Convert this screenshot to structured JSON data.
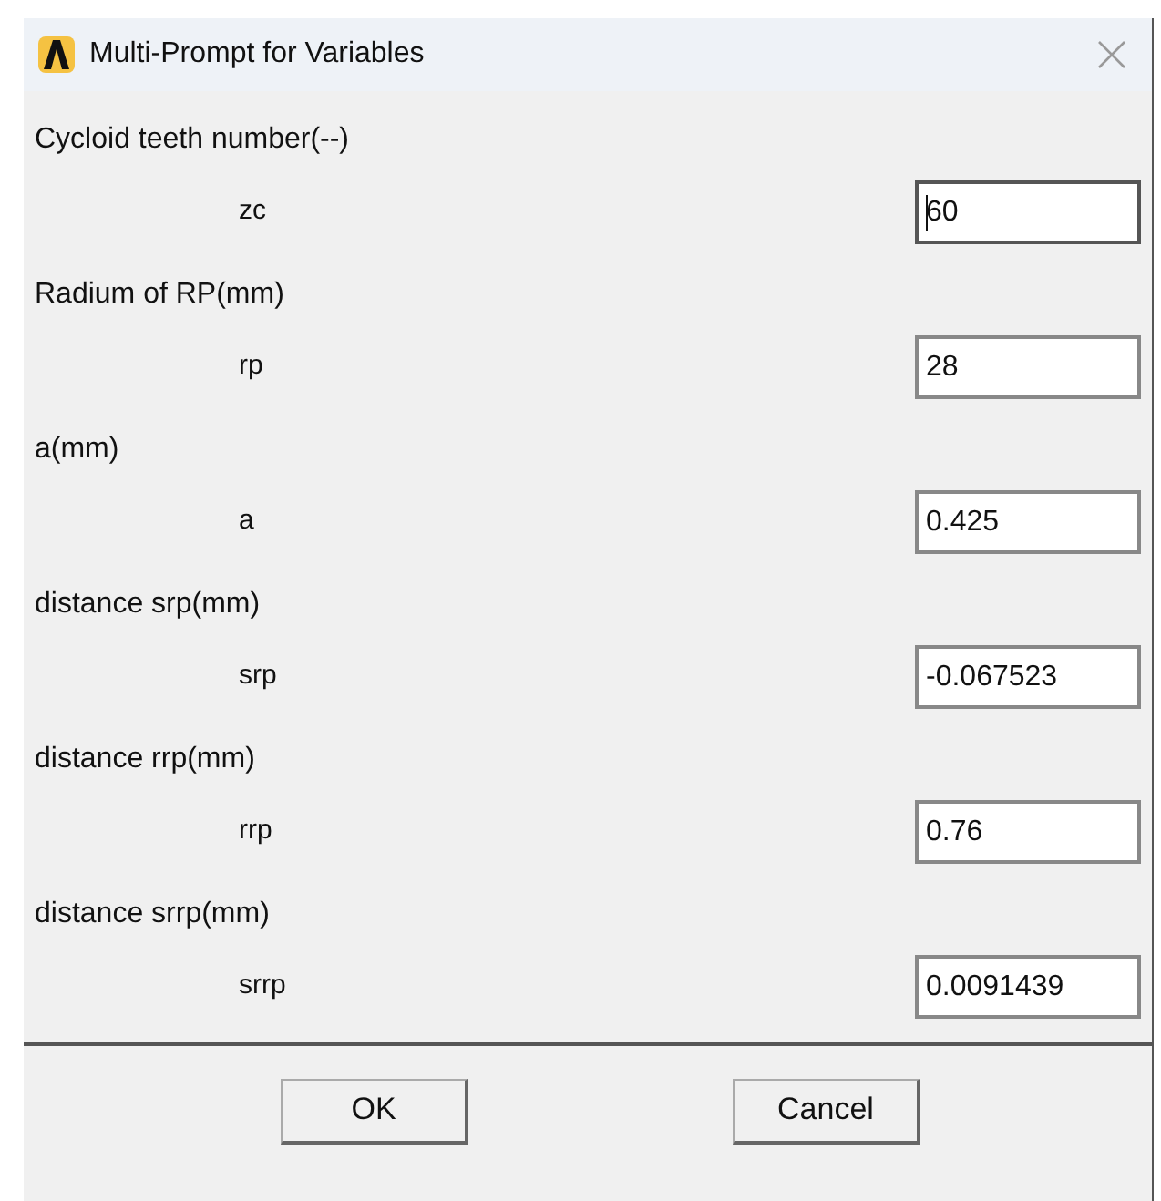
{
  "window": {
    "title": "Multi-Prompt for Variables"
  },
  "variables": [
    {
      "heading": "Cycloid teeth number(--)",
      "name": "zc",
      "value": "60",
      "focused": true
    },
    {
      "heading": "Radium of RP(mm)",
      "name": "rp",
      "value": "28",
      "focused": false
    },
    {
      "heading": "a(mm)",
      "name": "a",
      "value": "0.425",
      "focused": false
    },
    {
      "heading": "distance srp(mm)",
      "name": "srp",
      "value": "-0.067523",
      "focused": false
    },
    {
      "heading": "distance rrp(mm)",
      "name": "rrp",
      "value": "0.76",
      "focused": false
    },
    {
      "heading": "distance srrp(mm)",
      "name": "srrp",
      "value": "0.0091439",
      "focused": false
    }
  ],
  "buttons": [
    "OK",
    "Cancel"
  ]
}
